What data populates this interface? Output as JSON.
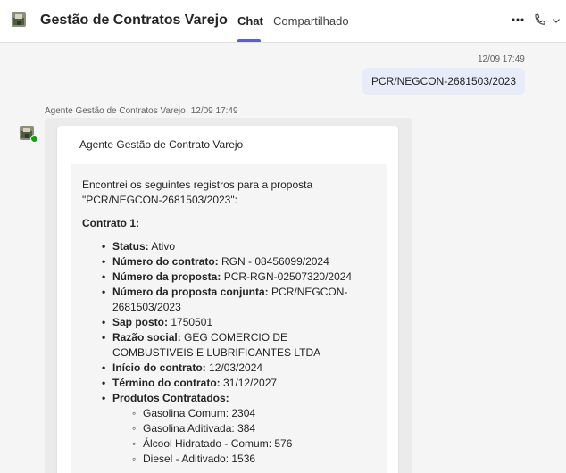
{
  "header": {
    "title": "Gestão de Contratos Varejo",
    "tabs": [
      {
        "label": "Chat",
        "active": true
      },
      {
        "label": "Compartilhado",
        "active": false
      }
    ],
    "accent_color": "#5b5fc7"
  },
  "messages": {
    "sent": {
      "time": "12/09 17:49",
      "text": "PCR/NEGCON-2681503/2023",
      "bubble_color": "#e8ebfa"
    },
    "reply": {
      "sender": "Agente Gestão de Contratos Varejo",
      "time": "12/09 17:49",
      "presence_color": "#13a10e",
      "card": {
        "title": "Agente Gestão de Contrato Varejo",
        "intro": "Encontrei os seguintes registros para a proposta \"PCR/NEGCON-2681503/2023\":",
        "contract_title": "Contrato 1:",
        "fields": [
          {
            "label": "Status:",
            "value": "Ativo"
          },
          {
            "label": "Número do contrato:",
            "value": "RGN - 08456099/2024"
          },
          {
            "label": "Número da proposta:",
            "value": "PCR-RGN-02507320/2024"
          },
          {
            "label": "Número da proposta conjunta:",
            "value": "PCR/NEGCON-2681503/2023"
          },
          {
            "label": "Sap posto:",
            "value": "1750501"
          },
          {
            "label": "Razão social:",
            "value": "GEG COMERCIO DE COMBUSTIVEIS E LUBRIFICANTES LTDA"
          },
          {
            "label": "Início do contrato:",
            "value": "12/03/2024"
          },
          {
            "label": "Término do contrato:",
            "value": "31/12/2027"
          },
          {
            "label": "Produtos Contratados:",
            "value": ""
          }
        ],
        "products": [
          "Gasolina Comum: 2304",
          "Gasolina Aditivada: 384",
          "Álcool Hidratado - Comum: 576",
          "Diesel - Aditivado: 1536"
        ]
      }
    }
  },
  "icons": [
    "app-logo-icon",
    "more-options-icon",
    "phone-icon",
    "chevron-down-icon",
    "bot-avatar-icon"
  ]
}
